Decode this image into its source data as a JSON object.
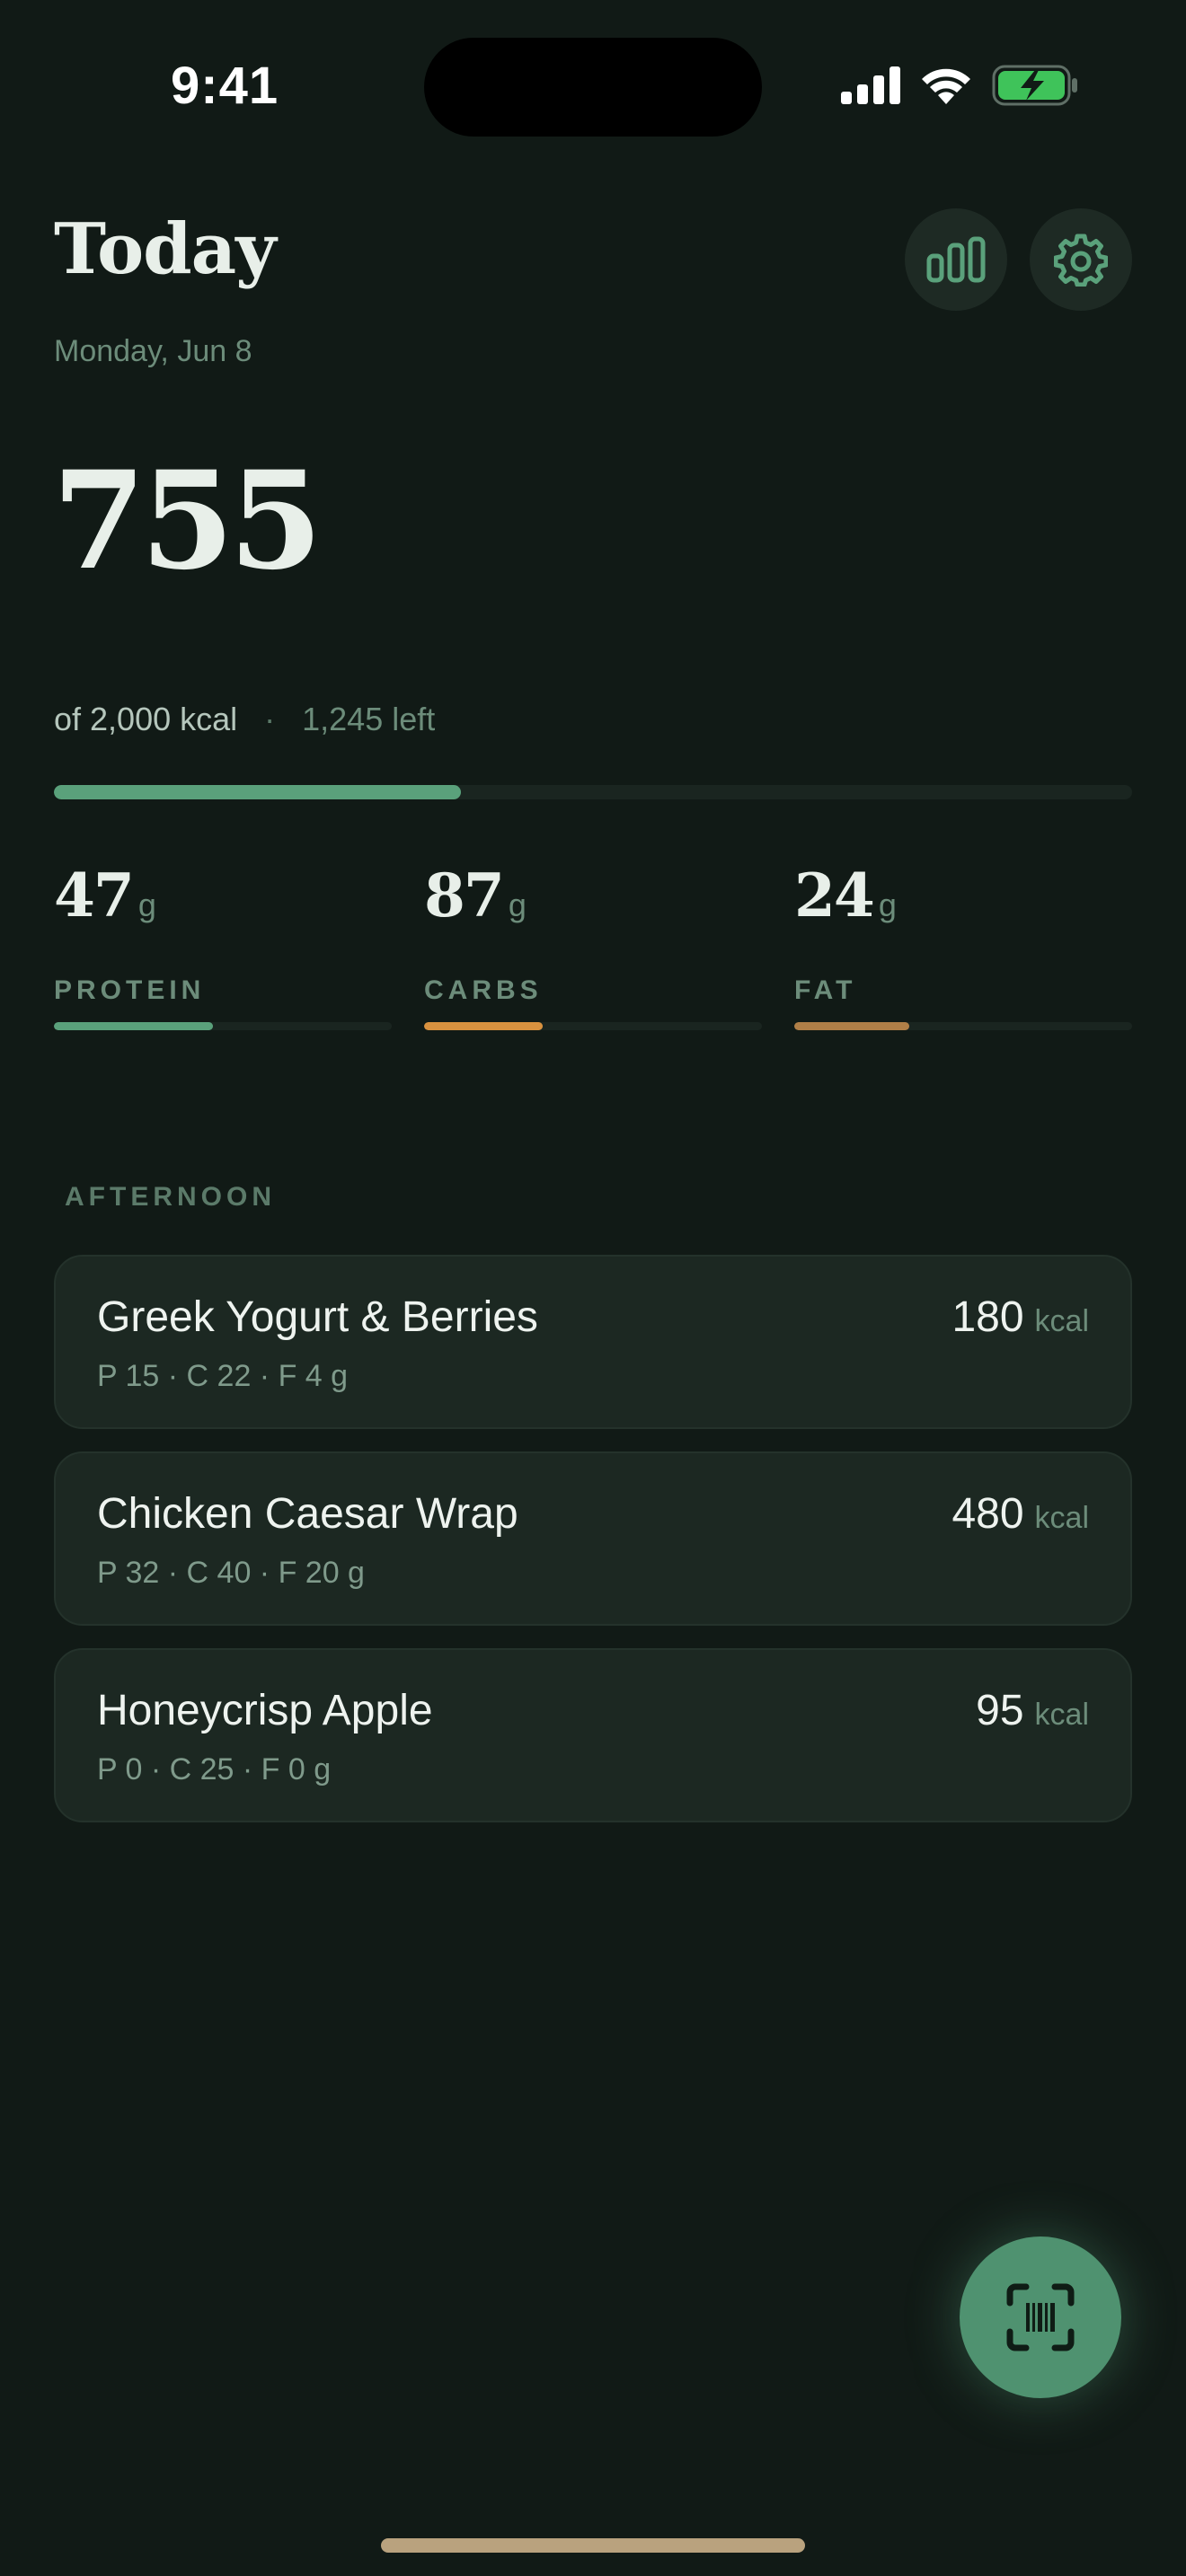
{
  "status_bar": {
    "time": "9:41"
  },
  "header": {
    "title": "Today",
    "date": "Monday, Jun 8",
    "stats_icon": "bar-chart-icon",
    "settings_icon": "gear-icon"
  },
  "calories": {
    "consumed": "755",
    "of_goal": "of 2,000 kcal",
    "separator": "·",
    "left": "1,245 left",
    "progress": 0.3775,
    "accent": "#5aa17b"
  },
  "macros": [
    {
      "value": "47",
      "unit": "g",
      "label": "PROTEIN",
      "progress": 0.47,
      "color": "#5aa17b"
    },
    {
      "value": "87",
      "unit": "g",
      "label": "CARBS",
      "progress": 0.35,
      "color": "#d9923f"
    },
    {
      "value": "24",
      "unit": "g",
      "label": "FAT",
      "progress": 0.34,
      "color": "#b07f47"
    }
  ],
  "section": {
    "label": "AFTERNOON"
  },
  "meals": [
    {
      "name": "Greek Yogurt & Berries",
      "macros": "P 15 · C 22 · F 4 g",
      "kcal": "180",
      "unit": "kcal"
    },
    {
      "name": "Chicken Caesar Wrap",
      "macros": "P 32 · C 40 · F 20 g",
      "kcal": "480",
      "unit": "kcal"
    },
    {
      "name": "Honeycrisp Apple",
      "macros": "P 0 · C 25 · F 0 g",
      "kcal": "95",
      "unit": "kcal"
    }
  ],
  "fab": {
    "icon": "barcode-scan-icon"
  }
}
